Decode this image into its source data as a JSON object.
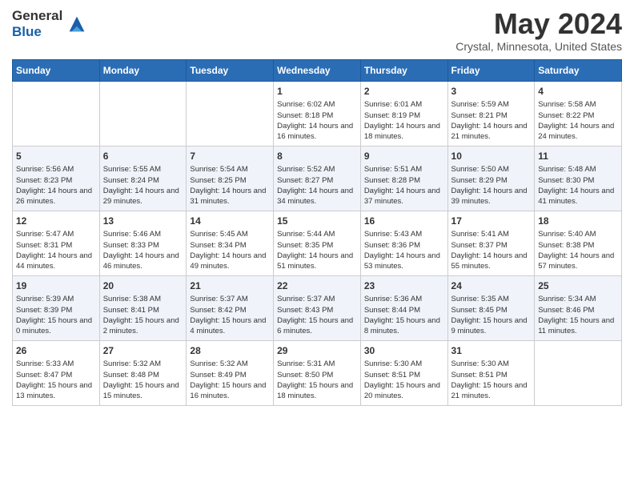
{
  "header": {
    "logo_line1": "General",
    "logo_line2": "Blue",
    "month_title": "May 2024",
    "subtitle": "Crystal, Minnesota, United States"
  },
  "days_of_week": [
    "Sunday",
    "Monday",
    "Tuesday",
    "Wednesday",
    "Thursday",
    "Friday",
    "Saturday"
  ],
  "weeks": [
    [
      {
        "day": "",
        "info": ""
      },
      {
        "day": "",
        "info": ""
      },
      {
        "day": "",
        "info": ""
      },
      {
        "day": "1",
        "info": "Sunrise: 6:02 AM\nSunset: 8:18 PM\nDaylight: 14 hours and 16 minutes."
      },
      {
        "day": "2",
        "info": "Sunrise: 6:01 AM\nSunset: 8:19 PM\nDaylight: 14 hours and 18 minutes."
      },
      {
        "day": "3",
        "info": "Sunrise: 5:59 AM\nSunset: 8:21 PM\nDaylight: 14 hours and 21 minutes."
      },
      {
        "day": "4",
        "info": "Sunrise: 5:58 AM\nSunset: 8:22 PM\nDaylight: 14 hours and 24 minutes."
      }
    ],
    [
      {
        "day": "5",
        "info": "Sunrise: 5:56 AM\nSunset: 8:23 PM\nDaylight: 14 hours and 26 minutes."
      },
      {
        "day": "6",
        "info": "Sunrise: 5:55 AM\nSunset: 8:24 PM\nDaylight: 14 hours and 29 minutes."
      },
      {
        "day": "7",
        "info": "Sunrise: 5:54 AM\nSunset: 8:25 PM\nDaylight: 14 hours and 31 minutes."
      },
      {
        "day": "8",
        "info": "Sunrise: 5:52 AM\nSunset: 8:27 PM\nDaylight: 14 hours and 34 minutes."
      },
      {
        "day": "9",
        "info": "Sunrise: 5:51 AM\nSunset: 8:28 PM\nDaylight: 14 hours and 37 minutes."
      },
      {
        "day": "10",
        "info": "Sunrise: 5:50 AM\nSunset: 8:29 PM\nDaylight: 14 hours and 39 minutes."
      },
      {
        "day": "11",
        "info": "Sunrise: 5:48 AM\nSunset: 8:30 PM\nDaylight: 14 hours and 41 minutes."
      }
    ],
    [
      {
        "day": "12",
        "info": "Sunrise: 5:47 AM\nSunset: 8:31 PM\nDaylight: 14 hours and 44 minutes."
      },
      {
        "day": "13",
        "info": "Sunrise: 5:46 AM\nSunset: 8:33 PM\nDaylight: 14 hours and 46 minutes."
      },
      {
        "day": "14",
        "info": "Sunrise: 5:45 AM\nSunset: 8:34 PM\nDaylight: 14 hours and 49 minutes."
      },
      {
        "day": "15",
        "info": "Sunrise: 5:44 AM\nSunset: 8:35 PM\nDaylight: 14 hours and 51 minutes."
      },
      {
        "day": "16",
        "info": "Sunrise: 5:43 AM\nSunset: 8:36 PM\nDaylight: 14 hours and 53 minutes."
      },
      {
        "day": "17",
        "info": "Sunrise: 5:41 AM\nSunset: 8:37 PM\nDaylight: 14 hours and 55 minutes."
      },
      {
        "day": "18",
        "info": "Sunrise: 5:40 AM\nSunset: 8:38 PM\nDaylight: 14 hours and 57 minutes."
      }
    ],
    [
      {
        "day": "19",
        "info": "Sunrise: 5:39 AM\nSunset: 8:39 PM\nDaylight: 15 hours and 0 minutes."
      },
      {
        "day": "20",
        "info": "Sunrise: 5:38 AM\nSunset: 8:41 PM\nDaylight: 15 hours and 2 minutes."
      },
      {
        "day": "21",
        "info": "Sunrise: 5:37 AM\nSunset: 8:42 PM\nDaylight: 15 hours and 4 minutes."
      },
      {
        "day": "22",
        "info": "Sunrise: 5:37 AM\nSunset: 8:43 PM\nDaylight: 15 hours and 6 minutes."
      },
      {
        "day": "23",
        "info": "Sunrise: 5:36 AM\nSunset: 8:44 PM\nDaylight: 15 hours and 8 minutes."
      },
      {
        "day": "24",
        "info": "Sunrise: 5:35 AM\nSunset: 8:45 PM\nDaylight: 15 hours and 9 minutes."
      },
      {
        "day": "25",
        "info": "Sunrise: 5:34 AM\nSunset: 8:46 PM\nDaylight: 15 hours and 11 minutes."
      }
    ],
    [
      {
        "day": "26",
        "info": "Sunrise: 5:33 AM\nSunset: 8:47 PM\nDaylight: 15 hours and 13 minutes."
      },
      {
        "day": "27",
        "info": "Sunrise: 5:32 AM\nSunset: 8:48 PM\nDaylight: 15 hours and 15 minutes."
      },
      {
        "day": "28",
        "info": "Sunrise: 5:32 AM\nSunset: 8:49 PM\nDaylight: 15 hours and 16 minutes."
      },
      {
        "day": "29",
        "info": "Sunrise: 5:31 AM\nSunset: 8:50 PM\nDaylight: 15 hours and 18 minutes."
      },
      {
        "day": "30",
        "info": "Sunrise: 5:30 AM\nSunset: 8:51 PM\nDaylight: 15 hours and 20 minutes."
      },
      {
        "day": "31",
        "info": "Sunrise: 5:30 AM\nSunset: 8:51 PM\nDaylight: 15 hours and 21 minutes."
      },
      {
        "day": "",
        "info": ""
      }
    ]
  ]
}
